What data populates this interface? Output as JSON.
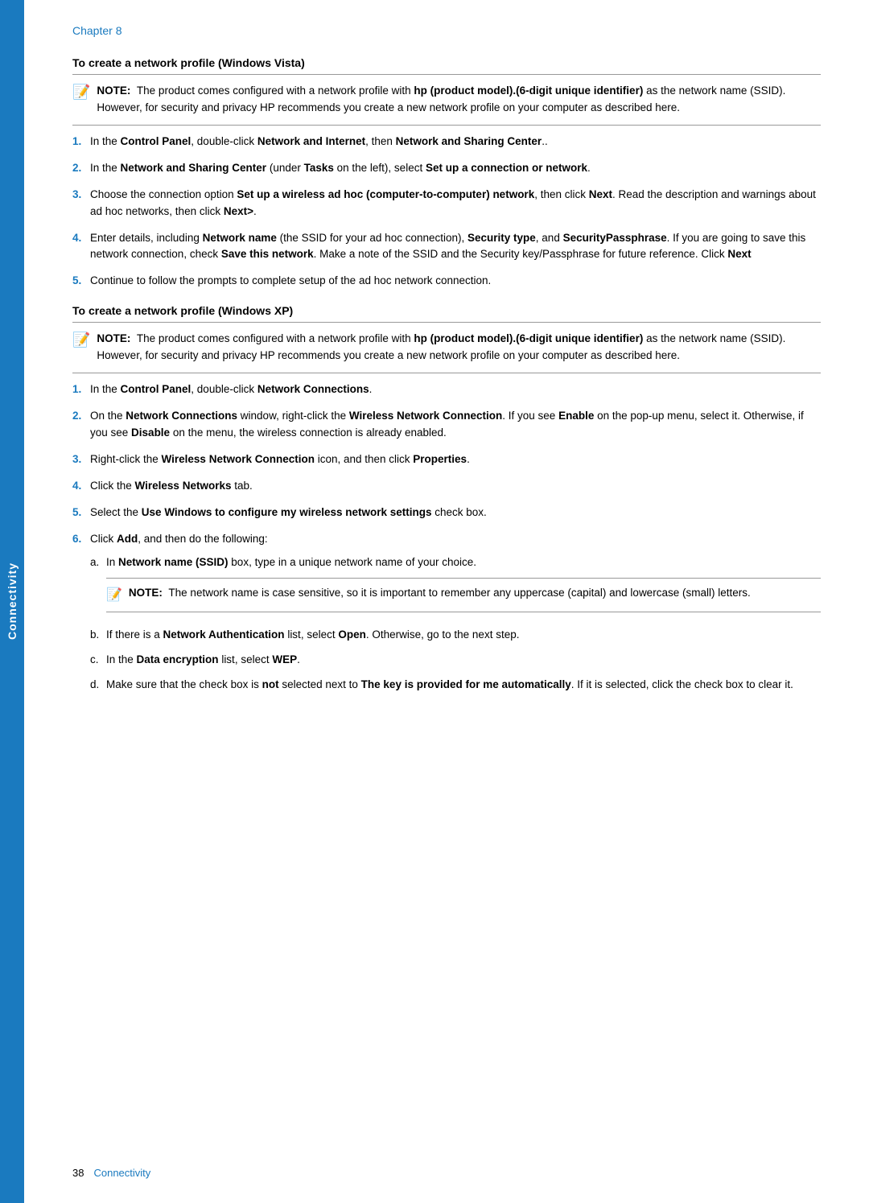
{
  "sidebar": {
    "label": "Connectivity"
  },
  "chapter": {
    "label": "Chapter 8"
  },
  "section1": {
    "heading": "To create a network profile (Windows Vista)"
  },
  "note1": {
    "prefix": "NOTE:",
    "text": "The product comes configured with a network profile with hp (product model).(6-digit unique identifier) as the network name (SSID). However, for security and privacy HP recommends you create a new network profile on your computer as described here."
  },
  "steps_vista": [
    {
      "num": "1.",
      "text": "In the Control Panel, double-click Network and Internet, then Network and Sharing Center.."
    },
    {
      "num": "2.",
      "text": "In the Network and Sharing Center (under Tasks on the left), select Set up a connection or network."
    },
    {
      "num": "3.",
      "text": "Choose the connection option Set up a wireless ad hoc (computer-to-computer) network, then click Next. Read the description and warnings about ad hoc networks, then click Next>."
    },
    {
      "num": "4.",
      "text": "Enter details, including Network name (the SSID for your ad hoc connection), Security type, and SecurityPassphrase. If you are going to save this network connection, check Save this network. Make a note of the SSID and the Security key/Passphrase for future reference. Click Next"
    },
    {
      "num": "5.",
      "text": "Continue to follow the prompts to complete setup of the ad hoc network connection."
    }
  ],
  "section2": {
    "heading": "To create a network profile (Windows XP)"
  },
  "note2": {
    "prefix": "NOTE:",
    "text": "The product comes configured with a network profile with hp (product model).(6-digit unique identifier) as the network name (SSID). However, for security and privacy HP recommends you create a new network profile on your computer as described here."
  },
  "steps_xp": [
    {
      "num": "1.",
      "text": "In the Control Panel, double-click Network Connections."
    },
    {
      "num": "2.",
      "text": "On the Network Connections window, right-click the Wireless Network Connection. If you see Enable on the pop-up menu, select it. Otherwise, if you see Disable on the menu, the wireless connection is already enabled."
    },
    {
      "num": "3.",
      "text": "Right-click the Wireless Network Connection icon, and then click Properties."
    },
    {
      "num": "4.",
      "text": "Click the Wireless Networks tab."
    },
    {
      "num": "5.",
      "text": "Select the Use Windows to configure my wireless network settings check box."
    },
    {
      "num": "6.",
      "text": "Click Add, and then do the following:",
      "sub": [
        {
          "label": "a.",
          "text": "In Network name (SSID) box, type in a unique network name of your choice.",
          "note": {
            "prefix": "NOTE:",
            "text": "The network name is case sensitive, so it is important to remember any uppercase (capital) and lowercase (small) letters."
          }
        },
        {
          "label": "b.",
          "text": "If there is a Network Authentication list, select Open. Otherwise, go to the next step."
        },
        {
          "label": "c.",
          "text": "In the Data encryption list, select WEP."
        },
        {
          "label": "d.",
          "text": "Make sure that the check box is not selected next to The key is provided for me automatically. If it is selected, click the check box to clear it."
        }
      ]
    }
  ],
  "footer": {
    "page_num": "38",
    "section": "Connectivity"
  }
}
